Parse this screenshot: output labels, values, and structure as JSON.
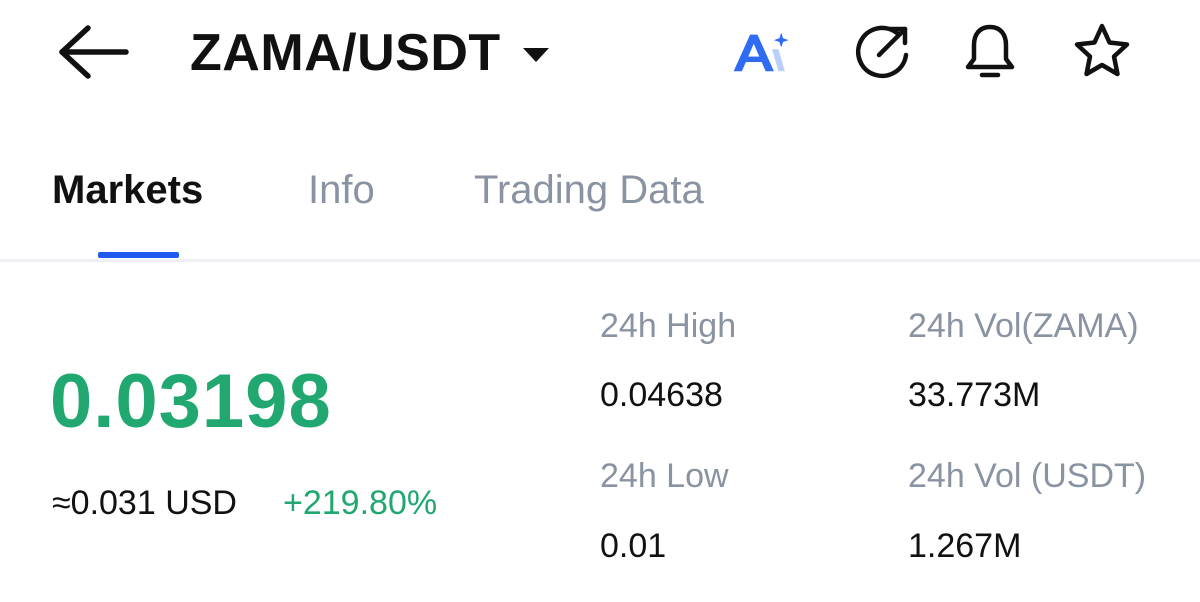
{
  "header": {
    "pair": "ZAMA/USDT",
    "icons": [
      "back-arrow-icon",
      "chevron-down-icon",
      "ai-icon",
      "share-icon",
      "bell-icon",
      "star-icon"
    ],
    "ai_colors": {
      "primary": "#2f6bf3",
      "secondary": "#b9d0fb"
    }
  },
  "tabs": [
    {
      "label": "Markets",
      "active": true
    },
    {
      "label": "Info",
      "active": false
    },
    {
      "label": "Trading Data",
      "active": false
    }
  ],
  "colors": {
    "accent": "#1f5af0",
    "positive": "#21a870",
    "muted_text": "#8a93a2",
    "text": "#111111"
  },
  "price": {
    "last": "0.03198",
    "usd_approx": "≈0.031 USD",
    "change": "+219.80%"
  },
  "stats": {
    "high_label": "24h High",
    "high_value": "0.04638",
    "low_label": "24h Low",
    "low_value": "0.01",
    "vol_base_label": "24h Vol(ZAMA)",
    "vol_base_value": "33.773M",
    "vol_quote_label": "24h Vol (USDT)",
    "vol_quote_value": "1.267M"
  }
}
